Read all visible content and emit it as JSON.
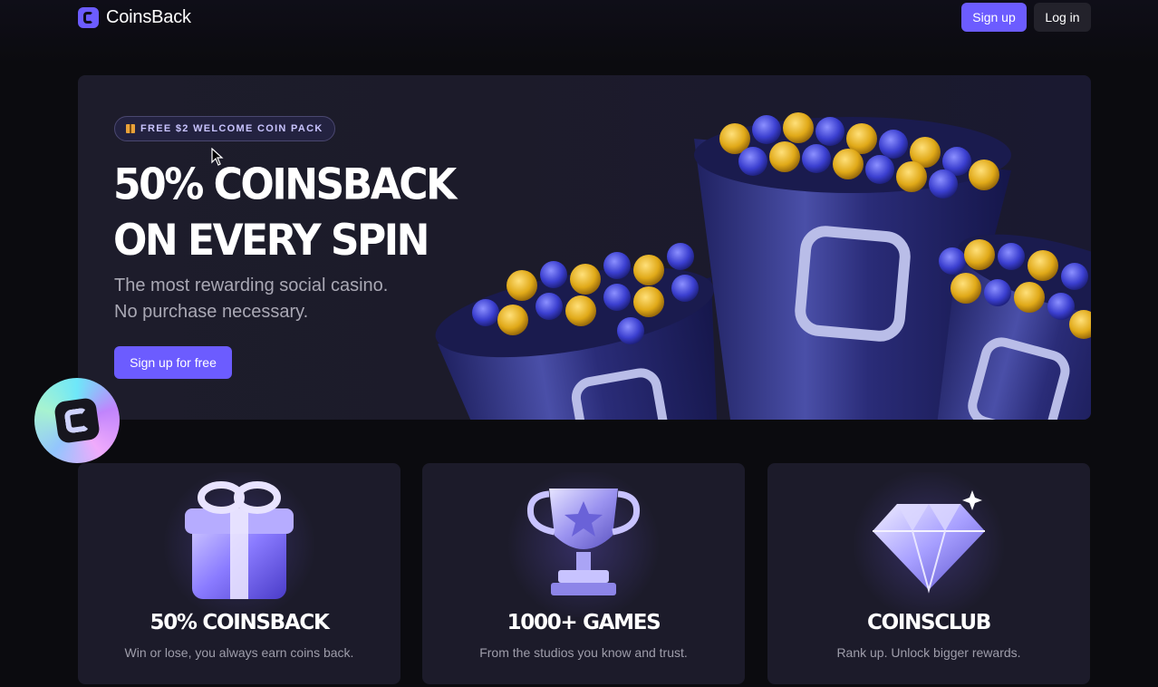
{
  "header": {
    "brand": "CoinsBack",
    "signup_label": "Sign up",
    "login_label": "Log in"
  },
  "hero": {
    "badge": "FREE $2 WELCOME COIN PACK",
    "title_line1": "50% COINSBACK",
    "title_line2": "ON EVERY SPIN",
    "sub_line1": "The most rewarding social casino.",
    "sub_line2": "No purchase necessary.",
    "cta_label": "Sign up for free"
  },
  "features": [
    {
      "title": "50% COINSBACK",
      "desc": "Win or lose, you always earn coins back.",
      "icon": "gift-icon"
    },
    {
      "title": "1000+ GAMES",
      "desc": "From the studios you know and trust.",
      "icon": "trophy-icon"
    },
    {
      "title": "COINSCLUB",
      "desc": "Rank up. Unlock bigger rewards.",
      "icon": "diamond-icon"
    }
  ],
  "colors": {
    "accent": "#6c5cff",
    "background": "#0b0b0f",
    "panel": "#1c1b2a",
    "coin_gold": "#e0a918",
    "coin_blue": "#3b3fd0"
  }
}
